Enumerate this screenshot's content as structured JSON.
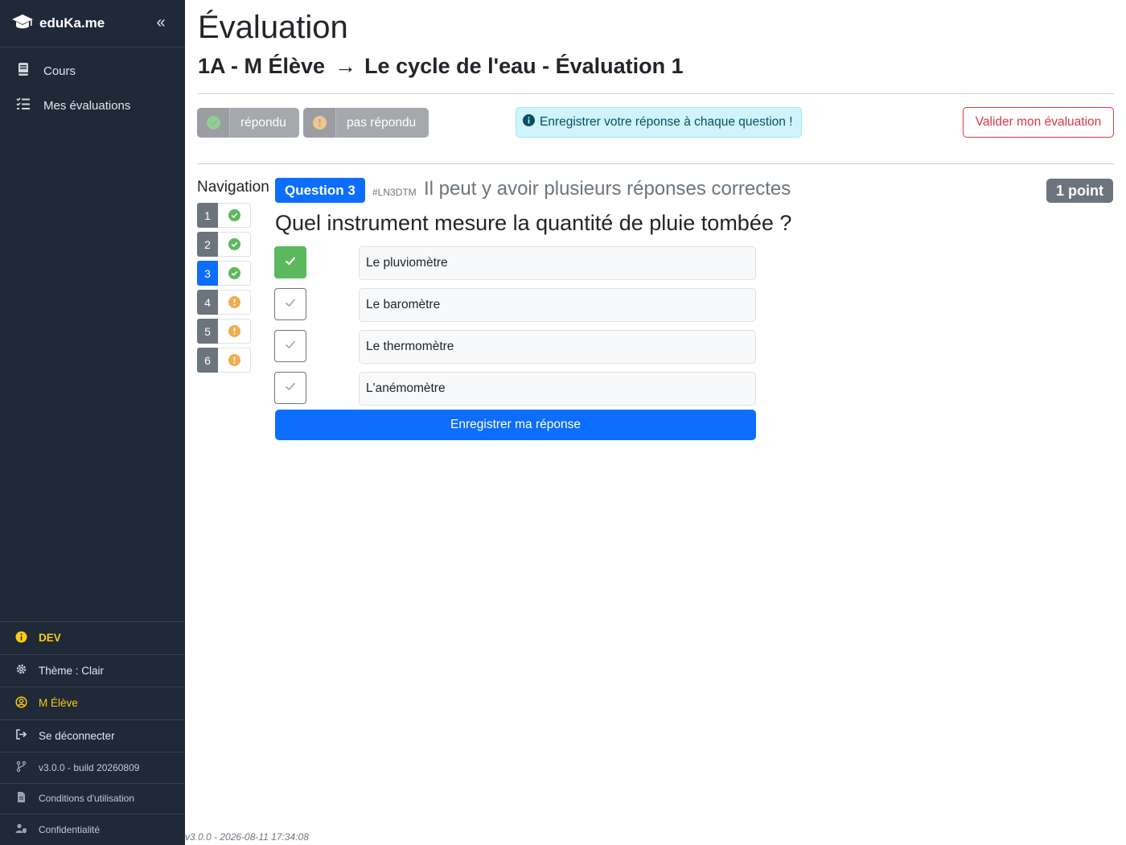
{
  "app": {
    "name": "eduKa.me"
  },
  "sidebar": {
    "collapse_icon": "«",
    "items": [
      {
        "label": "Cours",
        "icon": "book-icon"
      },
      {
        "label": "Mes évaluations",
        "icon": "list-check-icon"
      }
    ],
    "bottom": {
      "env": "DEV",
      "theme": "Thème : Clair",
      "user": "M Élève",
      "logout": "Se déconnecter",
      "version": "v3.0.0 - build 20260809",
      "terms": "Conditions d'utilisation",
      "privacy": "Confidentialité"
    }
  },
  "page": {
    "title": "Évaluation",
    "class_student": "1A - M Élève",
    "arrow": "→",
    "evaluation": "Le cycle de l'eau - Évaluation 1"
  },
  "toolbar": {
    "answered_label": "répondu",
    "unanswered_label": "pas répondu",
    "info_text": "Enregistrer votre réponse à chaque question !",
    "validate_label": "Valider mon évaluation"
  },
  "navigation": {
    "title": "Navigation",
    "questions": [
      {
        "num": "1",
        "status": "answered"
      },
      {
        "num": "2",
        "status": "answered"
      },
      {
        "num": "3",
        "status": "answered",
        "active": true
      },
      {
        "num": "4",
        "status": "unanswered"
      },
      {
        "num": "5",
        "status": "unanswered"
      },
      {
        "num": "6",
        "status": "unanswered"
      }
    ]
  },
  "question": {
    "badge": "Question 3",
    "code": "#LN3DTM",
    "hint": "Il peut y avoir plusieurs réponses correctes",
    "points": "1 point",
    "text": "Quel instrument mesure la quantité de pluie tombée ?",
    "answers": [
      {
        "label": "Le pluviomètre",
        "checked": true
      },
      {
        "label": "Le baromètre",
        "checked": false
      },
      {
        "label": "Le thermomètre",
        "checked": false
      },
      {
        "label": "L'anémomètre",
        "checked": false
      }
    ],
    "save_label": "Enregistrer ma réponse"
  },
  "footer": {
    "version": "v3.0.0 - 2026-08-11 17:34:08"
  },
  "colors": {
    "sidebar_bg": "#1f2937",
    "primary": "#0d6efd",
    "success": "#5cb85c",
    "warning": "#f0ad4e",
    "danger": "#dc3545",
    "secondary": "#6c757d"
  }
}
